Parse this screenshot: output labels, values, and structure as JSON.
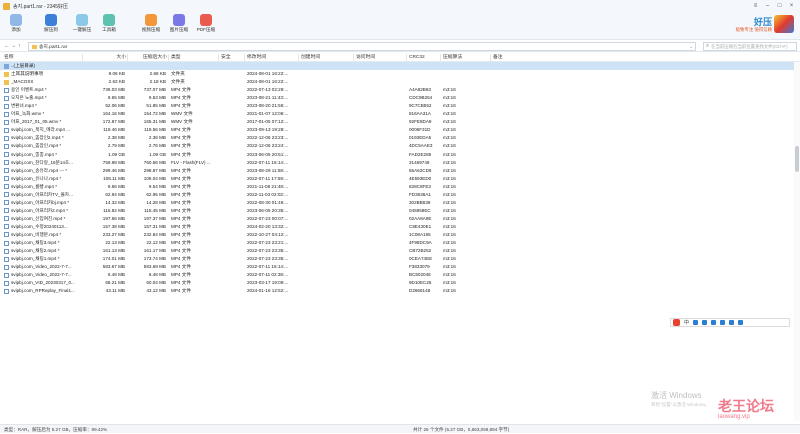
{
  "window": {
    "title": "송지.part1.rar - 2345好压"
  },
  "toolbar": {
    "items": [
      {
        "label": "添加",
        "color": "#8fb8e8"
      },
      {
        "label": "解压到",
        "color": "#3c7fd9"
      },
      {
        "label": "一键解压",
        "color": "#8cc9e8"
      },
      {
        "label": "工具箱",
        "color": "#5fc1b0"
      },
      {
        "label": "视频压缩",
        "color": "#f3973a"
      },
      {
        "label": "图片压缩",
        "color": "#7a77e6"
      },
      {
        "label": "PDF压缩",
        "color": "#ea5b4d"
      }
    ],
    "brand": {
      "name": "好压",
      "slogan": "极致专注 值得信赖"
    }
  },
  "address": {
    "path": "송지.part1.rar",
    "search_placeholder": "在当前压缩包当前位置查找文件(Ctrl+F)"
  },
  "columns": [
    "名称",
    "大小",
    "压缩后大小",
    "类型",
    "安全",
    "修改时间",
    "创建时间",
    "访问时间",
    "CRC32",
    "压缩算法",
    "备注"
  ],
  "files": [
    {
      "name": "..(上层目录)",
      "size": "",
      "packed": "",
      "type": "",
      "mtime": "",
      "crc": "",
      "method": "",
      "icon": "up"
    },
    {
      "name": "土耳其说明事项",
      "size": "9.06 KB",
      "packed": "2.68 KB",
      "type": "文件夹",
      "mtime": "2024-08-01 16:22:...",
      "crc": "",
      "method": "",
      "icon": "folder"
    },
    {
      "name": "_MACOSX",
      "size": "2.63 KB",
      "packed": "2.18 KB",
      "type": "文件夹",
      "mtime": "2024-08-01 16:22:...",
      "crc": "",
      "method": "",
      "icon": "folder"
    },
    {
      "name": "용인 이벤트.mp4 *",
      "size": "736.03 MB",
      "packed": "737.07 MB",
      "type": "MP4 文件",
      "mtime": "2022-07-13 02:29:...",
      "crc": "A4A82B63",
      "method": "m3:16",
      "icon": "video"
    },
    {
      "name": "오지은 노출.mp4 *",
      "size": "9.65 MB",
      "packed": "9.53 MB",
      "type": "MP4 文件",
      "mtime": "2023-08-21 11:43:...",
      "crc": "CDC9B254",
      "method": "m3:16",
      "icon": "video"
    },
    {
      "name": "변환녀.mp4 *",
      "size": "52.06 MB",
      "packed": "51.85 MB",
      "type": "MP4 文件",
      "mtime": "2023-08-20 21:56:...",
      "crc": "9C7CB552",
      "method": "m3:16",
      "icon": "video"
    },
    {
      "name": "아프_녹화.wmv *",
      "size": "164.16 MB",
      "packed": "154.72 MB",
      "type": "WMV 文件",
      "mtime": "2021-01-07 12:06:...",
      "crc": "816AA31A",
      "method": "m3:16",
      "icon": "video"
    },
    {
      "name": "아프_2017_01_05.wmv *",
      "size": "172.87 MB",
      "packed": "165.31 MB",
      "type": "WMV 文件",
      "mtime": "2017-01-05 07:12:...",
      "crc": "92FE8DA9",
      "method": "m3:16",
      "icon": "video"
    },
    {
      "name": "svipbj.com_북지_메라.mp4 ...",
      "size": "119.46 MB",
      "packed": "119.56 MB",
      "type": "MP4 文件",
      "mtime": "2023-09-13 19:28:...",
      "crc": "0006F31D",
      "method": "m3:16",
      "icon": "video"
    },
    {
      "name": "svipbj.com_뽐잡인2.mp4 *",
      "size": "2.38 MB",
      "packed": "2.36 MB",
      "type": "MP4 文件",
      "mtime": "2022-12-06 23:23:...",
      "crc": "0193EDA5",
      "method": "m3:16",
      "icon": "video"
    },
    {
      "name": "svipbj.com_뽐잡인.mp4 *",
      "size": "2.79 MB",
      "packed": "2.76 MB",
      "type": "MP4 文件",
      "mtime": "2022-12-06 23:24:...",
      "crc": "4DC5AAE3",
      "method": "m3:16",
      "icon": "video"
    },
    {
      "name": "svipbj.com_뽕뽕.mp4 *",
      "size": "1.09 GB",
      "packed": "1.09 GB",
      "type": "MP4 文件",
      "mtime": "2023-06-05 20:51:...",
      "crc": "FAD2E285",
      "method": "m3:16",
      "icon": "video"
    },
    {
      "name": "svipbj.com_찬다랑_16분14초...",
      "size": "759.98 MB",
      "packed": "760.56 MB",
      "type": "FLV - Flash(FLV) ...",
      "mtime": "2022-07-11 16:14:...",
      "crc": "31469749",
      "method": "m3:16",
      "icon": "video"
    },
    {
      "name": "svipbj.com_송유라.mp4 --- *",
      "size": "299.46 MB",
      "packed": "298.87 MB",
      "type": "MP4 文件",
      "mtime": "2023-08-29 11:58:...",
      "crc": "55A62CD6",
      "method": "m3:16",
      "icon": "video"
    },
    {
      "name": "svipbj.com_유나나.mp4 *",
      "size": "108.11 MB",
      "packed": "108.04 MB",
      "type": "MP4 文件",
      "mtime": "2022-07-11 17:59:...",
      "crc": "4E593ED0",
      "method": "m3:16",
      "icon": "video"
    },
    {
      "name": "svipbj.com_룸빵.mp4 *",
      "size": "9.56 MB",
      "packed": "9.54 MB",
      "type": "MP4 文件",
      "mtime": "2021-11-08 21:48:...",
      "crc": "828C8FE3",
      "method": "m3:16",
      "icon": "video"
    },
    {
      "name": "svipbj.com_아프리카TV_몰카...",
      "size": "62.94 MB",
      "packed": "62.95 MB",
      "type": "MP4 文件",
      "mtime": "2022-11-03 02:02:...",
      "crc": "FD3636A1",
      "method": "m3:16",
      "icon": "video"
    },
    {
      "name": "svipbj.com_아프리카bj.mp4 *",
      "size": "14.32 MB",
      "packed": "14.28 MB",
      "type": "MP4 文件",
      "mtime": "2022-08-30 01:46:...",
      "crc": "302BB639",
      "method": "m3:16",
      "icon": "video"
    },
    {
      "name": "svipbj.com_아프리카2.mp4 *",
      "size": "115.82 MB",
      "packed": "115.45 MB",
      "type": "MP4 文件",
      "mtime": "2023-06-05 20:35:...",
      "crc": "045958EC",
      "method": "m3:16",
      "icon": "video"
    },
    {
      "name": "svipbj.com_신입여친.mp4 *",
      "size": "197.56 MB",
      "packed": "197.37 MB",
      "type": "MP4 文件",
      "mtime": "2022-07-23 00:07:...",
      "crc": "02AA8A9E",
      "method": "m3:16",
      "icon": "video"
    },
    {
      "name": "svipbj.com_수정20240113...",
      "size": "157.38 MB",
      "packed": "157.31 MB",
      "type": "MP4 文件",
      "mtime": "2024-02-20 13:32:...",
      "crc": "C8E430E1",
      "method": "m3:16",
      "icon": "video"
    },
    {
      "name": "svipbj.com_비행분.mp4 *",
      "size": "233.27 MB",
      "packed": "232.84 MB",
      "type": "MP4 文件",
      "mtime": "2022-10-27 04:12:...",
      "crc": "1C08A165",
      "method": "m3:16",
      "icon": "video"
    },
    {
      "name": "svipbj.com_채팅3.mp4 *",
      "size": "22.13 MB",
      "packed": "22.12 MB",
      "type": "MP4 文件",
      "mtime": "2022-07-23 23:21:...",
      "crc": "4F98DC9A",
      "method": "m3:16",
      "icon": "video"
    },
    {
      "name": "svipbj.com_채팅2.mp4 *",
      "size": "161.13 MB",
      "packed": "161.17 MB",
      "type": "MP4 文件",
      "mtime": "2022-07-23 23:35:...",
      "crc": "CB72B252",
      "method": "m3:16",
      "icon": "video"
    },
    {
      "name": "svipbj.com_채팅1.mp4 *",
      "size": "174.01 MB",
      "packed": "173.74 MB",
      "type": "MP4 文件",
      "mtime": "2022-07-23 23:35:...",
      "crc": "0CEA74EE",
      "method": "m3:16",
      "icon": "video"
    },
    {
      "name": "svipbj.com_Video_2022-7-7...",
      "size": "583.67 MB",
      "packed": "583.69 MB",
      "type": "MP4 文件",
      "mtime": "2022-07-11 16:14:...",
      "crc": "F3833079",
      "method": "m3:16",
      "icon": "video"
    },
    {
      "name": "svipbj.com_Video_2022-7-7...",
      "size": "6.48 MB",
      "packed": "6.48 MB",
      "type": "MP4 文件",
      "mtime": "2022-07-11 02:38:...",
      "crc": "BC502046",
      "method": "m3:16",
      "icon": "video"
    },
    {
      "name": "svipbj.com_VID_20230317_0...",
      "size": "68.21 MB",
      "packed": "60.04 MB",
      "type": "MP4 文件",
      "mtime": "2023-03-17 19:09:...",
      "crc": "9D10EC25",
      "method": "m3:16",
      "icon": "video"
    },
    {
      "name": "svipbj.com_RPReplay_Final1...",
      "size": "43.11 MB",
      "packed": "43.12 MB",
      "type": "MP4 文件",
      "mtime": "2024-01-16 12:52:...",
      "crc": "D2668148",
      "method": "m3:16",
      "icon": "video"
    }
  ],
  "ime": {
    "label": "中"
  },
  "watermark": {
    "activate": "激活 Windows",
    "activate_hint": "转到\"设置\"以激活 Windows。",
    "site": "老王论坛",
    "url": "laowang.vip"
  },
  "status": {
    "left": "类型：RAR，解压后为 5.27 GB，压缩率：99.42%",
    "right": "共计 26 个文件 (5.27 GB，5,663,059,894 字节)"
  }
}
